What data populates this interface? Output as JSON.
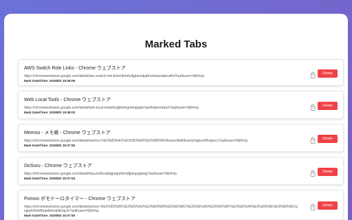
{
  "page": {
    "title": "Marked Tabs",
    "accent_color": "#f04246",
    "background_gradient": [
      "#6a72d8",
      "#7a5fc4"
    ]
  },
  "tabs": [
    {
      "title": "AWS Switch Role Links - Chrome ウェブストア",
      "url": "https://chromewebstore.google.com/detail/aws-switch-role-links/dhmfodjgbloodjabhcbbakoakkcafhd?authuser=0&hl=ja",
      "date": "Mark Date/Time: 2025/8/2 15:08:06",
      "delete_label": "Delete",
      "lock_icon": "lock-icon"
    },
    {
      "title": "Web Local Tools - Chrome ウェブストア",
      "url": "https://chromewebstore.google.com/detail/web-local-tools/dcgfphehgebmppglenlacfkafpembpch?authuser=0&hl=ja",
      "date": "Mark Date/Time: 2025/8/2 15:08:02",
      "delete_label": "Delete",
      "lock_icon": "lock-icon"
    },
    {
      "title": "Memoo - メモ帳 - Chrome ウェブストア",
      "url": "https://chromewebstore.google.com/detail/memoo-%E3%83%A1%E3%83%A2%E5%B8%B3/koamollekfifoamckhgkcefifhopincc?authuser=0&hl=ja",
      "date": "Mark Date/Time: 2025/8/2 15:07:56",
      "delete_label": "Delete",
      "lock_icon": "lock-icon"
    },
    {
      "title": "DoSuru - Chrome ウェブストア",
      "url": "https://chromewebstore.google.com/detail/dosuru/feonljdgjoppethmdfjpkoppgeejg?authuser=0&hl=ja",
      "date": "Mark Date/Time: 2025/8/2 15:07:54",
      "delete_label": "Delete",
      "lock_icon": "lock-icon"
    },
    {
      "title": "Pomoo ポモドーロタイマー - Chrome ウェブストア",
      "url": "https://chromewebstore.google.com/detail/pomoo-%E3%83%9D%E3%83%A2%E3%83%89%E3%83%BC%E3%83%AD%E3%82%BF%E3%82%A4%E3%83%9E%E3%83%BC/gejpafchhmfkiejafiahobibkogclc?authuser=0&hl=ja",
      "date": "Mark Date/Time: 2025/8/2 15:07:50",
      "delete_label": "Delete",
      "lock_icon": "lock-icon"
    }
  ]
}
